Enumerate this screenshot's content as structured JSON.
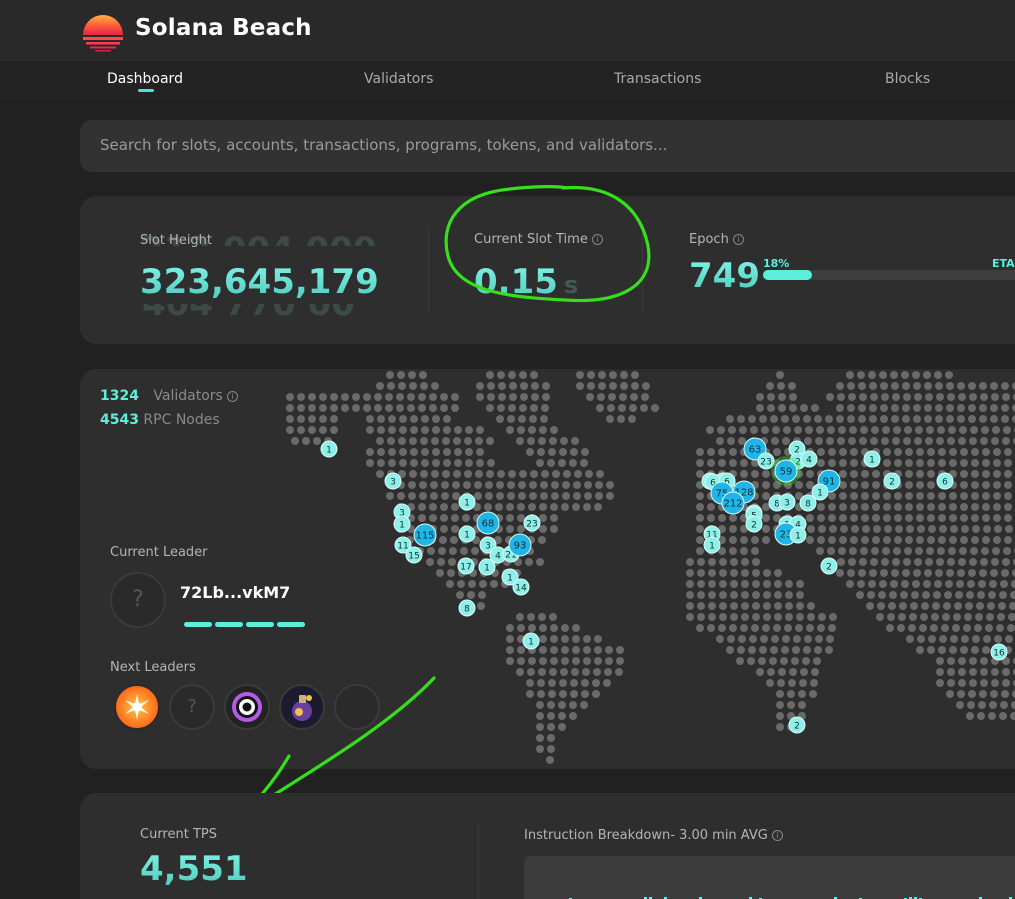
{
  "brand": {
    "name": "Solana Beach"
  },
  "nav": {
    "dashboard": "Dashboard",
    "validators": "Validators",
    "transactions": "Transactions",
    "blocks": "Blocks"
  },
  "search": {
    "placeholder": "Search for slots, accounts, transactions, programs, tokens, and validators..."
  },
  "stats": {
    "slot_height_label": "Slot Height",
    "slot_height_value": "323,645,179",
    "slot_time_label": "Current Slot Time",
    "slot_time_value": "0.15",
    "slot_time_unit": "s",
    "epoch_label": "Epoch",
    "epoch_value": "749",
    "epoch_percent_label": "18%",
    "epoch_progress": 0.18,
    "eta_label": "ETA"
  },
  "network": {
    "validators_count": "1324",
    "validators_label": "Validators",
    "rpc_count": "4543",
    "rpc_label": "RPC Nodes"
  },
  "leader": {
    "current_label": "Current Leader",
    "current_name": "72Lb...vkM7",
    "next_label": "Next Leaders"
  },
  "map_markers": [
    "1",
    "3",
    "3",
    "1",
    "11",
    "15",
    "115",
    "1",
    "17",
    "1",
    "8",
    "1",
    "68",
    "3",
    "23",
    "4",
    "21",
    "93",
    "1",
    "14",
    "1",
    "6",
    "3",
    "2",
    "63",
    "23",
    "2",
    "4",
    "59",
    "91",
    "1",
    "2",
    "6",
    "1",
    "6",
    "6",
    "75",
    "128",
    "212",
    "5",
    "8",
    "3",
    "8",
    "5",
    "2",
    "1",
    "4",
    "23",
    "1",
    "11",
    "1",
    "2",
    "16",
    "2"
  ],
  "tps": {
    "label": "Current TPS",
    "value": "4,551",
    "breakdown_label": "Instruction Breakdown- 3.00 min AVG"
  },
  "colors": {
    "accent": "#4fe3d6",
    "marker": "#8ff0ea",
    "marker_big": "#1fb5e8",
    "annotation": "#35e01a"
  }
}
